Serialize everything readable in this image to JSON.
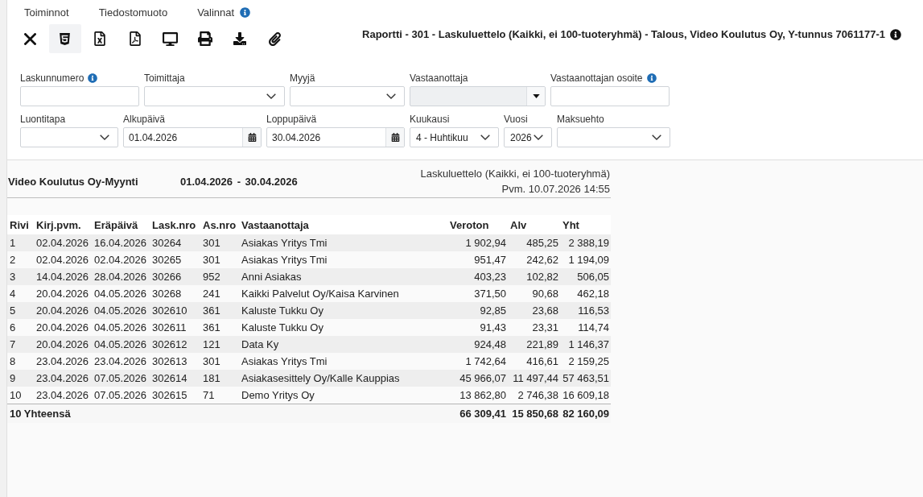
{
  "menu": [
    {
      "label": "Toiminnot",
      "info": false
    },
    {
      "label": "Tiedostomuoto",
      "info": false
    },
    {
      "label": "Valinnat",
      "info": true
    }
  ],
  "toolbar": [
    {
      "kind": "close",
      "selected": false
    },
    {
      "kind": "html",
      "selected": true
    },
    {
      "kind": "excel",
      "selected": false
    },
    {
      "kind": "pdf",
      "selected": false
    },
    {
      "kind": "screen",
      "selected": false
    },
    {
      "kind": "print",
      "selected": false
    },
    {
      "kind": "download",
      "selected": false
    },
    {
      "kind": "attachment",
      "selected": false
    }
  ],
  "report_title": {
    "text": "Raportti - 301 - Laskuluettelo (Kaikki, ei 100-tuoteryhmä) - Talous, Video Koulutus Oy, Y-tunnus 7061177-1",
    "info": true
  },
  "filter_rows": [
    [
      {
        "label": "Laskunnumero",
        "kind": "text",
        "info": true,
        "disabled": false
      },
      {
        "label": "Toimittaja",
        "kind": "select",
        "info": false,
        "disabled": false
      },
      {
        "label": "Myyjä",
        "kind": "select",
        "info": false,
        "disabled": false
      },
      {
        "label": "Vastaanottaja",
        "kind": "combo",
        "info": false,
        "disabled": true
      },
      {
        "label": "Vastaanottajan osoite",
        "kind": "text",
        "info": true,
        "disabled": false
      }
    ],
    [
      {
        "label": "Luontitapa",
        "kind": "select",
        "info": false,
        "disabled": false
      },
      {
        "label": "Alkupäivä",
        "kind": "date",
        "value": "01.04.2026",
        "info": false,
        "disabled": false
      },
      {
        "label": "Loppupäivä",
        "kind": "date",
        "value": "30.04.2026",
        "info": false,
        "disabled": false
      },
      {
        "label": "Kuukausi",
        "kind": "select",
        "value": "4 - Huhtikuu",
        "info": false,
        "disabled": false
      },
      {
        "label": "Vuosi",
        "kind": "select",
        "value": "2026",
        "info": false,
        "disabled": false
      },
      {
        "label": "Maksuehto",
        "kind": "select",
        "info": false,
        "disabled": false
      }
    ]
  ],
  "report": {
    "company": "Video Koulutus Oy-Myynti",
    "period": "01.04.2026 - 30.04.2026",
    "report_name": "Laskuluettelo (Kaikki, ei 100-tuoteryhmä)",
    "printed": "Pvm. 10.07.2026 14:55",
    "table": {
      "columns": [
        {
          "label": "Rivi",
          "kind": "text"
        },
        {
          "label": "Kirj.pvm.",
          "kind": "text"
        },
        {
          "label": "Eräpäivä",
          "kind": "text"
        },
        {
          "label": "Lask.nro",
          "kind": "text"
        },
        {
          "label": "As.nro",
          "kind": "text"
        },
        {
          "label": "Vastaanottaja",
          "kind": "text"
        },
        {
          "label": "Veroton",
          "kind": "number"
        },
        {
          "label": "Alv",
          "kind": "number"
        },
        {
          "label": "Yht",
          "kind": "number"
        }
      ],
      "rows": [
        [
          "1",
          "02.04.2026",
          "16.04.2026",
          "30264",
          "301",
          "Asiakas Yritys Tmi",
          "1 902,94",
          "485,25",
          "2 388,19"
        ],
        [
          "2",
          "02.04.2026",
          "02.04.2026",
          "30265",
          "301",
          "Asiakas Yritys Tmi",
          "951,47",
          "242,62",
          "1 194,09"
        ],
        [
          "3",
          "14.04.2026",
          "28.04.2026",
          "30266",
          "952",
          "Anni Asiakas",
          "403,23",
          "102,82",
          "506,05"
        ],
        [
          "4",
          "20.04.2026",
          "04.05.2026",
          "30268",
          "241",
          "Kaikki Palvelut Oy/Kaisa Karvinen",
          "371,50",
          "90,68",
          "462,18"
        ],
        [
          "5",
          "20.04.2026",
          "04.05.2026",
          "302610",
          "361",
          "Kaluste Tukku Oy",
          "92,85",
          "23,68",
          "116,53"
        ],
        [
          "6",
          "20.04.2026",
          "04.05.2026",
          "302611",
          "361",
          "Kaluste Tukku Oy",
          "91,43",
          "23,31",
          "114,74"
        ],
        [
          "7",
          "20.04.2026",
          "04.05.2026",
          "302612",
          "121",
          "Data Ky",
          "924,48",
          "221,89",
          "1 146,37"
        ],
        [
          "8",
          "23.04.2026",
          "23.04.2026",
          "302613",
          "301",
          "Asiakas Yritys Tmi",
          "1 742,64",
          "416,61",
          "2 159,25"
        ],
        [
          "9",
          "23.04.2026",
          "07.05.2026",
          "302614",
          "181",
          "Asiakasesittely Oy/Kalle Kauppias",
          "45 966,07",
          "11 497,44",
          "57 463,51"
        ],
        [
          "10",
          "23.04.2026",
          "07.05.2026",
          "302615",
          "71",
          "Demo Yritys Oy",
          "13 862,80",
          "2 746,38",
          "16 609,18"
        ]
      ],
      "footer": {
        "label": "10 Yhteensä",
        "totals": [
          "66 309,41",
          "15 850,68",
          "82 160,09"
        ]
      }
    }
  }
}
